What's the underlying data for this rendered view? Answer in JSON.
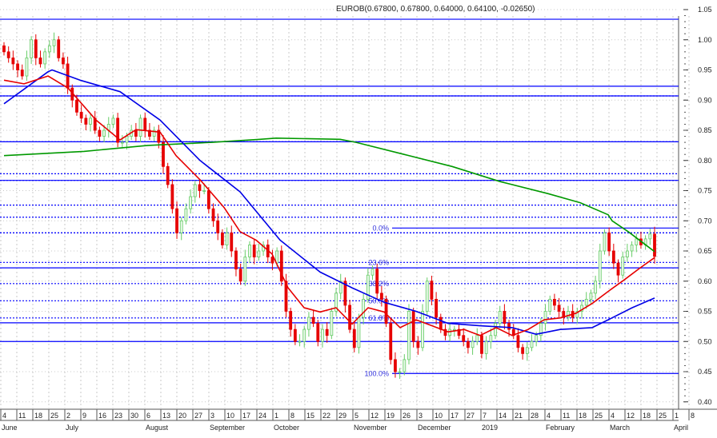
{
  "chart_data": {
    "type": "candlestick",
    "title": "EUROB(0.67800, 0.67800, 0.64000, 0.64100, -0.02650)",
    "ylim": [
      0.4,
      1.05
    ],
    "y_ticks": [
      "1.05",
      "1.00",
      "0.95",
      "0.90",
      "0.85",
      "0.80",
      "0.75",
      "0.70",
      "0.65",
      "0.60",
      "0.55",
      "0.50",
      "0.45",
      "0.40"
    ],
    "x_unit": "weeks since June 4",
    "x_ticks": [
      {
        "w": 0,
        "label": "4",
        "month": "June"
      },
      {
        "w": 1,
        "label": "11"
      },
      {
        "w": 2,
        "label": "18"
      },
      {
        "w": 3,
        "label": "25"
      },
      {
        "w": 4,
        "label": "2",
        "month": "July"
      },
      {
        "w": 5,
        "label": "9"
      },
      {
        "w": 6,
        "label": "16"
      },
      {
        "w": 7,
        "label": "23"
      },
      {
        "w": 8,
        "label": "30"
      },
      {
        "w": 9,
        "label": "6",
        "month": "August"
      },
      {
        "w": 10,
        "label": "13"
      },
      {
        "w": 11,
        "label": "20"
      },
      {
        "w": 12,
        "label": "27"
      },
      {
        "w": 13,
        "label": "3",
        "month": "September"
      },
      {
        "w": 14,
        "label": "10"
      },
      {
        "w": 15,
        "label": "17"
      },
      {
        "w": 16,
        "label": "24"
      },
      {
        "w": 17,
        "label": "1",
        "month": "October"
      },
      {
        "w": 18,
        "label": "8"
      },
      {
        "w": 19,
        "label": "15"
      },
      {
        "w": 20,
        "label": "22"
      },
      {
        "w": 21,
        "label": "29"
      },
      {
        "w": 22,
        "label": "5",
        "month": "November"
      },
      {
        "w": 23,
        "label": "12"
      },
      {
        "w": 24,
        "label": "19"
      },
      {
        "w": 25,
        "label": "26"
      },
      {
        "w": 26,
        "label": "3",
        "month": "December"
      },
      {
        "w": 27,
        "label": "10"
      },
      {
        "w": 28,
        "label": "17"
      },
      {
        "w": 29,
        "label": "27"
      },
      {
        "w": 30,
        "label": "7",
        "month": "2019"
      },
      {
        "w": 31,
        "label": "14"
      },
      {
        "w": 32,
        "label": "21"
      },
      {
        "w": 33,
        "label": "28"
      },
      {
        "w": 34,
        "label": "4",
        "month": "February"
      },
      {
        "w": 35,
        "label": "11"
      },
      {
        "w": 36,
        "label": "18"
      },
      {
        "w": 37,
        "label": "25"
      },
      {
        "w": 38,
        "label": "4",
        "month": "March"
      },
      {
        "w": 39,
        "label": "12"
      },
      {
        "w": 40,
        "label": "18"
      },
      {
        "w": 41,
        "label": "25"
      },
      {
        "w": 42,
        "label": "1",
        "month": "April"
      },
      {
        "w": 43,
        "label": "8"
      }
    ],
    "last_week": 40.65,
    "closes": [
      0.98,
      0.97,
      0.96,
      0.95,
      0.94,
      0.97,
      1.0,
      0.97,
      0.96,
      0.98,
      0.99,
      1.0,
      0.97,
      0.96,
      0.92,
      0.9,
      0.88,
      0.87,
      0.86,
      0.87,
      0.85,
      0.84,
      0.85,
      0.86,
      0.87,
      0.83,
      0.83,
      0.84,
      0.85,
      0.84,
      0.87,
      0.85,
      0.84,
      0.85,
      0.83,
      0.79,
      0.76,
      0.72,
      0.68,
      0.7,
      0.72,
      0.74,
      0.76,
      0.75,
      0.75,
      0.72,
      0.7,
      0.68,
      0.66,
      0.68,
      0.65,
      0.62,
      0.6,
      0.64,
      0.66,
      0.64,
      0.65,
      0.66,
      0.64,
      0.63,
      0.65,
      0.6,
      0.55,
      0.52,
      0.5,
      0.5,
      0.52,
      0.54,
      0.53,
      0.5,
      0.52,
      0.51,
      0.55,
      0.58,
      0.6,
      0.56,
      0.52,
      0.49,
      0.54,
      0.57,
      0.61,
      0.62,
      0.58,
      0.57,
      0.53,
      0.47,
      0.45,
      0.45,
      0.47,
      0.55,
      0.5,
      0.49,
      0.55,
      0.6,
      0.57,
      0.54,
      0.52,
      0.51,
      0.52,
      0.52,
      0.51,
      0.5,
      0.49,
      0.5,
      0.51,
      0.48,
      0.5,
      0.51,
      0.53,
      0.55,
      0.53,
      0.52,
      0.51,
      0.49,
      0.48,
      0.49,
      0.5,
      0.51,
      0.53,
      0.55,
      0.57,
      0.56,
      0.55,
      0.54,
      0.55,
      0.54,
      0.55,
      0.56,
      0.57,
      0.58,
      0.6,
      0.65,
      0.68,
      0.65,
      0.63,
      0.61,
      0.64,
      0.65,
      0.66,
      0.67,
      0.66,
      0.67,
      0.678,
      0.641
    ],
    "ma_short": {
      "color": "#e60000",
      "points": [
        [
          0,
          0.933
        ],
        [
          1.25,
          0.927
        ],
        [
          2.75,
          0.94
        ],
        [
          4,
          0.92
        ],
        [
          5.75,
          0.867
        ],
        [
          7.25,
          0.834
        ],
        [
          8.25,
          0.851
        ],
        [
          9.75,
          0.847
        ],
        [
          10.75,
          0.808
        ],
        [
          12.25,
          0.768
        ],
        [
          13.75,
          0.722
        ],
        [
          14.75,
          0.682
        ],
        [
          15.75,
          0.668
        ],
        [
          16.75,
          0.645
        ],
        [
          17.75,
          0.589
        ],
        [
          18.75,
          0.556
        ],
        [
          19.75,
          0.549
        ],
        [
          20.75,
          0.556
        ],
        [
          21.75,
          0.529
        ],
        [
          22.75,
          0.556
        ],
        [
          23.75,
          0.549
        ],
        [
          24.75,
          0.523
        ],
        [
          25.75,
          0.536
        ],
        [
          26.75,
          0.526
        ],
        [
          27.75,
          0.516
        ],
        [
          28.75,
          0.52
        ],
        [
          29.75,
          0.51
        ],
        [
          30.75,
          0.523
        ],
        [
          31.75,
          0.51
        ],
        [
          32.75,
          0.52
        ],
        [
          33.75,
          0.536
        ],
        [
          34.75,
          0.539
        ],
        [
          35.75,
          0.547
        ],
        [
          36.75,
          0.563
        ],
        [
          37.75,
          0.583
        ],
        [
          38.75,
          0.602
        ],
        [
          39.75,
          0.622
        ],
        [
          40.65,
          0.639
        ]
      ]
    },
    "ma_mid": {
      "color": "#0000e6",
      "points": [
        [
          0,
          0.894
        ],
        [
          2.75,
          0.947
        ],
        [
          3,
          0.95
        ],
        [
          4.75,
          0.933
        ],
        [
          7.25,
          0.914
        ],
        [
          9.75,
          0.867
        ],
        [
          12.25,
          0.8
        ],
        [
          14.75,
          0.748
        ],
        [
          17.25,
          0.668
        ],
        [
          19.75,
          0.615
        ],
        [
          21.75,
          0.589
        ],
        [
          23.75,
          0.565
        ],
        [
          25.75,
          0.55
        ],
        [
          27.75,
          0.53
        ],
        [
          29.75,
          0.526
        ],
        [
          31.75,
          0.523
        ],
        [
          33.25,
          0.512
        ],
        [
          34.75,
          0.52
        ],
        [
          36.75,
          0.523
        ],
        [
          37.75,
          0.536
        ],
        [
          39.25,
          0.556
        ],
        [
          40.65,
          0.572
        ]
      ]
    },
    "ma_long": {
      "color": "#009900",
      "points": [
        [
          0,
          0.808
        ],
        [
          5,
          0.815
        ],
        [
          9,
          0.825
        ],
        [
          13,
          0.83
        ],
        [
          16,
          0.835
        ],
        [
          17,
          0.837
        ],
        [
          21,
          0.835
        ],
        [
          22,
          0.83
        ],
        [
          25,
          0.81
        ],
        [
          28,
          0.79
        ],
        [
          31,
          0.765
        ],
        [
          34,
          0.745
        ],
        [
          36,
          0.73
        ],
        [
          37.75,
          0.71
        ],
        [
          38,
          0.7
        ],
        [
          39,
          0.682
        ],
        [
          40.65,
          0.649
        ]
      ]
    },
    "h_lines_solid": [
      1.034,
      0.923,
      0.907,
      0.831,
      0.767,
      0.622,
      0.531,
      0.5
    ],
    "h_lines_dotted": [
      0.907,
      0.831,
      0.778,
      0.767,
      0.726,
      0.706,
      0.68
    ],
    "fibonacci": {
      "start_week": 24.25,
      "high": 0.688,
      "low": 0.447,
      "levels": [
        {
          "label": "0.0%",
          "value": 0.688
        },
        {
          "label": "23.6%",
          "value": 0.631
        },
        {
          "label": "38.2%",
          "value": 0.596
        },
        {
          "label": "50.0%",
          "value": 0.5675
        },
        {
          "label": "61.8%",
          "value": 0.539
        },
        {
          "label": "100.0%",
          "value": 0.447
        }
      ]
    },
    "colors": {
      "up": "#66cc66",
      "down": "#e60000",
      "grid": "#c8c8c8",
      "line": "#0000ff"
    }
  }
}
